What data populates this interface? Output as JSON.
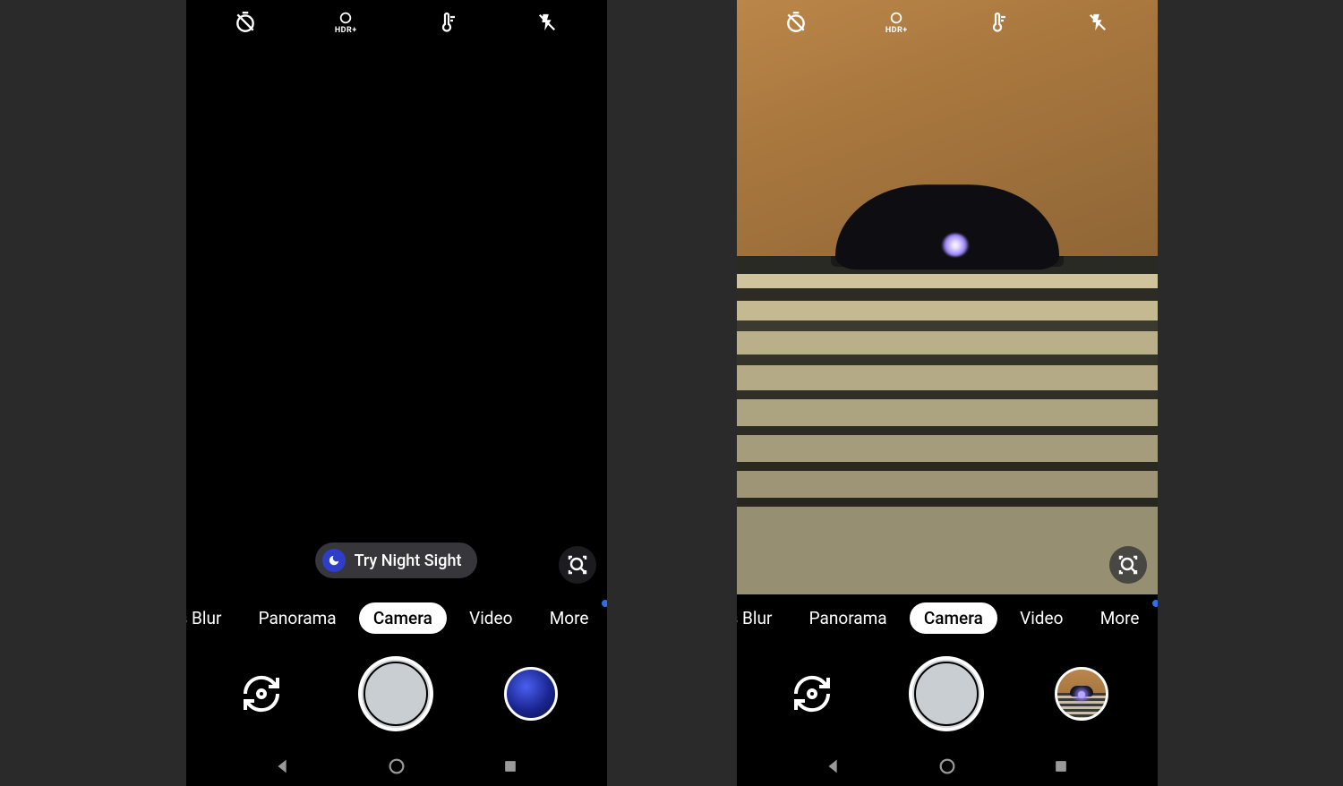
{
  "left": {
    "top_icons": [
      "timer-off",
      "hdr-plus",
      "temperature",
      "flash-off"
    ],
    "chip_label": "Try Night Sight",
    "modes": [
      "s Blur",
      "Panorama",
      "Camera",
      "Video",
      "More"
    ],
    "active_mode_index": 2,
    "thumb_kind": "blue"
  },
  "right": {
    "top_icons": [
      "timer-off",
      "hdr-plus",
      "temperature",
      "flash-off"
    ],
    "modes": [
      "s Blur",
      "Panorama",
      "Camera",
      "Video",
      "More"
    ],
    "active_mode_index": 2,
    "thumb_kind": "photo"
  },
  "hdr_label": "HDR+",
  "nav_icons": [
    "back",
    "home",
    "recent"
  ]
}
